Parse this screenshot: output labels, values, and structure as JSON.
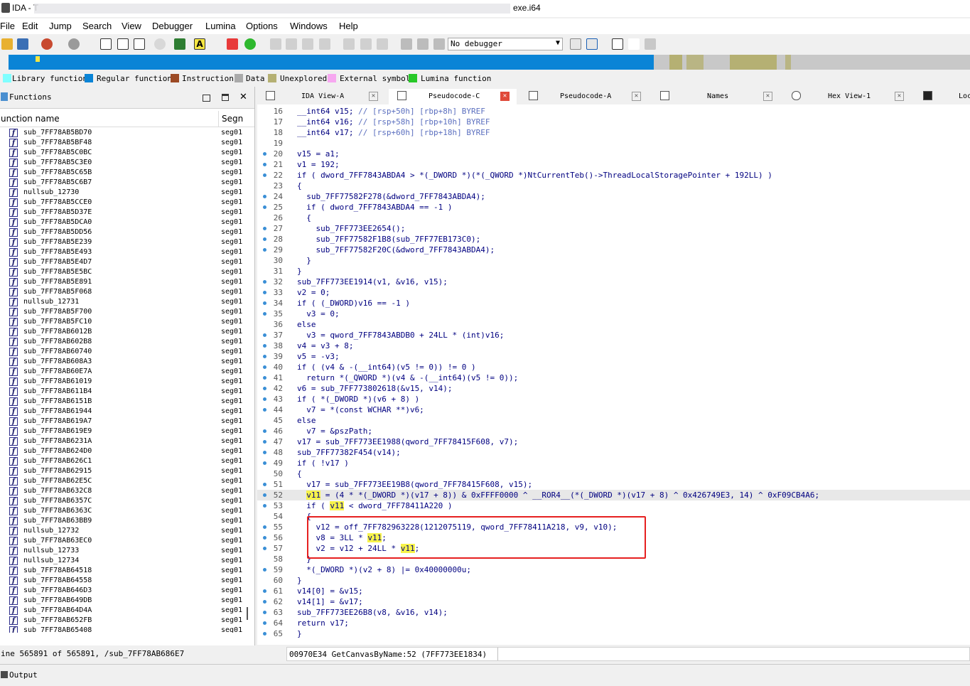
{
  "window": {
    "title_prefix": "IDA - T",
    "title_suffix": "exe.i64"
  },
  "menu": [
    "File",
    "Edit",
    "Jump",
    "Search",
    "View",
    "Debugger",
    "Lumina",
    "Options",
    "Windows",
    "Help"
  ],
  "toolbar": {
    "debugger_select": "No debugger"
  },
  "legend": [
    {
      "label": "Library function",
      "color": "#80ffff"
    },
    {
      "label": "Regular function",
      "color": "#0a84d6"
    },
    {
      "label": "Instruction",
      "color": "#9c4a25"
    },
    {
      "label": "Data",
      "color": "#aaaaaa"
    },
    {
      "label": "Unexplored",
      "color": "#b5b073"
    },
    {
      "label": "External symbol",
      "color": "#f7a8f0"
    },
    {
      "label": "Lumina function",
      "color": "#28c828"
    }
  ],
  "functions_panel": {
    "title": "Functions",
    "col_name": "unction name",
    "col_segment": "Segn",
    "rows": [
      {
        "name": "sub_7FF78AB5BD70",
        "seg": "seg01"
      },
      {
        "name": "sub_7FF78AB5BF48",
        "seg": "seg01"
      },
      {
        "name": "sub_7FF78AB5C0BC",
        "seg": "seg01"
      },
      {
        "name": "sub_7FF78AB5C3E0",
        "seg": "seg01"
      },
      {
        "name": "sub_7FF78AB5C65B",
        "seg": "seg01"
      },
      {
        "name": "sub_7FF78AB5C6B7",
        "seg": "seg01"
      },
      {
        "name": "nullsub_12730",
        "seg": "seg01"
      },
      {
        "name": "sub_7FF78AB5CCE0",
        "seg": "seg01"
      },
      {
        "name": "sub_7FF78AB5D37E",
        "seg": "seg01"
      },
      {
        "name": "sub_7FF78AB5DCA0",
        "seg": "seg01"
      },
      {
        "name": "sub_7FF78AB5DD56",
        "seg": "seg01"
      },
      {
        "name": "sub_7FF78AB5E239",
        "seg": "seg01"
      },
      {
        "name": "sub_7FF78AB5E493",
        "seg": "seg01"
      },
      {
        "name": "sub_7FF78AB5E4D7",
        "seg": "seg01"
      },
      {
        "name": "sub_7FF78AB5E5BC",
        "seg": "seg01"
      },
      {
        "name": "sub_7FF78AB5E891",
        "seg": "seg01"
      },
      {
        "name": "sub_7FF78AB5F068",
        "seg": "seg01"
      },
      {
        "name": "nullsub_12731",
        "seg": "seg01"
      },
      {
        "name": "sub_7FF78AB5F700",
        "seg": "seg01"
      },
      {
        "name": "sub_7FF78AB5FC10",
        "seg": "seg01"
      },
      {
        "name": "sub_7FF78AB6012B",
        "seg": "seg01"
      },
      {
        "name": "sub_7FF78AB602B8",
        "seg": "seg01"
      },
      {
        "name": "sub_7FF78AB60740",
        "seg": "seg01"
      },
      {
        "name": "sub_7FF78AB608A3",
        "seg": "seg01"
      },
      {
        "name": "sub_7FF78AB60E7A",
        "seg": "seg01"
      },
      {
        "name": "sub_7FF78AB61019",
        "seg": "seg01"
      },
      {
        "name": "sub_7FF78AB611B4",
        "seg": "seg01"
      },
      {
        "name": "sub_7FF78AB6151B",
        "seg": "seg01"
      },
      {
        "name": "sub_7FF78AB61944",
        "seg": "seg01"
      },
      {
        "name": "sub_7FF78AB619A7",
        "seg": "seg01"
      },
      {
        "name": "sub_7FF78AB619E9",
        "seg": "seg01"
      },
      {
        "name": "sub_7FF78AB6231A",
        "seg": "seg01"
      },
      {
        "name": "sub_7FF78AB624D0",
        "seg": "seg01"
      },
      {
        "name": "sub_7FF78AB626C1",
        "seg": "seg01"
      },
      {
        "name": "sub_7FF78AB62915",
        "seg": "seg01"
      },
      {
        "name": "sub_7FF78AB62E5C",
        "seg": "seg01"
      },
      {
        "name": "sub_7FF78AB632C8",
        "seg": "seg01"
      },
      {
        "name": "sub_7FF78AB6357C",
        "seg": "seg01"
      },
      {
        "name": "sub_7FF78AB6363C",
        "seg": "seg01"
      },
      {
        "name": "sub_7FF78AB63BB9",
        "seg": "seg01"
      },
      {
        "name": "nullsub_12732",
        "seg": "seg01"
      },
      {
        "name": "sub_7FF78AB63EC0",
        "seg": "seg01"
      },
      {
        "name": "nullsub_12733",
        "seg": "seg01"
      },
      {
        "name": "nullsub_12734",
        "seg": "seg01"
      },
      {
        "name": "sub_7FF78AB64518",
        "seg": "seg01"
      },
      {
        "name": "sub_7FF78AB64558",
        "seg": "seg01"
      },
      {
        "name": "sub_7FF78AB646D3",
        "seg": "seg01"
      },
      {
        "name": "sub_7FF78AB649DB",
        "seg": "seg01"
      },
      {
        "name": "sub_7FF78AB64D4A",
        "seg": "seg01"
      },
      {
        "name": "sub_7FF78AB652FB",
        "seg": "seg01"
      },
      {
        "name": "sub_7FF78AB65408",
        "seg": "seg01"
      }
    ],
    "status": "ine 565891 of 565891, /sub_7FF78AB686E7"
  },
  "tabs": [
    {
      "label": "IDA View-A"
    },
    {
      "label": "Pseudocode-C"
    },
    {
      "label": "Pseudocode-A"
    },
    {
      "label": "Names"
    },
    {
      "label": "Hex View-1"
    },
    {
      "label": "Loc"
    }
  ],
  "code_lines": [
    {
      "n": "16",
      "dot": false,
      "t": "__int64 v15; // [rsp+50h] [rbp+8h] BYREF"
    },
    {
      "n": "17",
      "dot": false,
      "t": "__int64 v16; // [rsp+58h] [rbp+10h] BYREF"
    },
    {
      "n": "18",
      "dot": false,
      "t": "__int64 v17; // [rsp+60h] [rbp+18h] BYREF"
    },
    {
      "n": "19",
      "dot": false,
      "t": ""
    },
    {
      "n": "20",
      "dot": true,
      "t": "v15 = a1;"
    },
    {
      "n": "21",
      "dot": true,
      "t": "v1 = 192;"
    },
    {
      "n": "22",
      "dot": true,
      "t": "if ( dword_7FF7843ABDA4 > *(_DWORD *)(*(_QWORD *)NtCurrentTeb()->ThreadLocalStoragePointer + 192LL) )"
    },
    {
      "n": "23",
      "dot": false,
      "t": "{"
    },
    {
      "n": "24",
      "dot": true,
      "t": "  sub_7FF77582F278(&dword_7FF7843ABDA4);"
    },
    {
      "n": "25",
      "dot": true,
      "t": "  if ( dword_7FF7843ABDA4 == -1 )"
    },
    {
      "n": "26",
      "dot": false,
      "t": "  {"
    },
    {
      "n": "27",
      "dot": true,
      "t": "    sub_7FF773EE2654();"
    },
    {
      "n": "28",
      "dot": true,
      "t": "    sub_7FF77582F1B8(sub_7FF77EB173C0);"
    },
    {
      "n": "29",
      "dot": true,
      "t": "    sub_7FF77582F20C(&dword_7FF7843ABDA4);"
    },
    {
      "n": "30",
      "dot": false,
      "t": "  }"
    },
    {
      "n": "31",
      "dot": false,
      "t": "}"
    },
    {
      "n": "32",
      "dot": true,
      "t": "sub_7FF773EE1914(v1, &v16, v15);"
    },
    {
      "n": "33",
      "dot": true,
      "t": "v2 = 0;"
    },
    {
      "n": "34",
      "dot": true,
      "t": "if ( (_DWORD)v16 == -1 )"
    },
    {
      "n": "35",
      "dot": true,
      "t": "  v3 = 0;"
    },
    {
      "n": "36",
      "dot": false,
      "t": "else"
    },
    {
      "n": "37",
      "dot": true,
      "t": "  v3 = qword_7FF7843ABDB0 + 24LL * (int)v16;"
    },
    {
      "n": "38",
      "dot": true,
      "t": "v4 = v3 + 8;"
    },
    {
      "n": "39",
      "dot": true,
      "t": "v5 = -v3;"
    },
    {
      "n": "40",
      "dot": true,
      "t": "if ( (v4 & -(__int64)(v5 != 0)) != 0 )"
    },
    {
      "n": "41",
      "dot": true,
      "t": "  return *(_QWORD *)(v4 & -(__int64)(v5 != 0));"
    },
    {
      "n": "42",
      "dot": true,
      "t": "v6 = sub_7FF773802618(&v15, v14);"
    },
    {
      "n": "43",
      "dot": true,
      "t": "if ( *(_DWORD *)(v6 + 8) )"
    },
    {
      "n": "44",
      "dot": true,
      "t": "  v7 = *(const WCHAR **)v6;"
    },
    {
      "n": "45",
      "dot": false,
      "t": "else"
    },
    {
      "n": "46",
      "dot": true,
      "t": "  v7 = &pszPath;"
    },
    {
      "n": "47",
      "dot": true,
      "t": "v17 = sub_7FF773EE1988(qword_7FF78415F608, v7);"
    },
    {
      "n": "48",
      "dot": true,
      "t": "sub_7FF77382F454(v14);"
    },
    {
      "n": "49",
      "dot": true,
      "t": "if ( !v17 )"
    },
    {
      "n": "50",
      "dot": false,
      "t": "{"
    },
    {
      "n": "51",
      "dot": true,
      "t": "  v17 = sub_7FF773EE19B8(qword_7FF78415F608, v15);"
    },
    {
      "n": "52",
      "dot": true,
      "t": "  v11 = (4 * *(_DWORD *)(v17 + 8)) & 0xFFFF0000 ^ __ROR4__(*(_DWORD *)(v17 + 8) ^ 0x426749E3, 14) ^ 0xF09CB4A6;"
    },
    {
      "n": "53",
      "dot": true,
      "t": "  if ( v11 < dword_7FF78411A220 )"
    },
    {
      "n": "54",
      "dot": false,
      "t": "  {"
    },
    {
      "n": "55",
      "dot": true,
      "t": "    v12 = off_7FF782963228(1212075119, qword_7FF78411A218, v9, v10);"
    },
    {
      "n": "56",
      "dot": true,
      "t": "    v8 = 3LL * v11;"
    },
    {
      "n": "57",
      "dot": true,
      "t": "    v2 = v12 + 24LL * v11;"
    },
    {
      "n": "58",
      "dot": false,
      "t": "  }"
    },
    {
      "n": "59",
      "dot": true,
      "t": "  *(_DWORD *)(v2 + 8) |= 0x40000000u;"
    },
    {
      "n": "60",
      "dot": false,
      "t": "}"
    },
    {
      "n": "61",
      "dot": true,
      "t": "v14[0] = &v15;"
    },
    {
      "n": "62",
      "dot": true,
      "t": "v14[1] = &v17;"
    },
    {
      "n": "63",
      "dot": true,
      "t": "sub_7FF773EE26B8(v8, &v16, v14);"
    },
    {
      "n": "64",
      "dot": true,
      "t": "return v17;"
    },
    {
      "n": "65",
      "dot": true,
      "t": "}"
    }
  ],
  "code_status": "00970E34 GetCanvasByName:52 (7FF773EE1834)",
  "output_panel": {
    "title": "Output"
  }
}
